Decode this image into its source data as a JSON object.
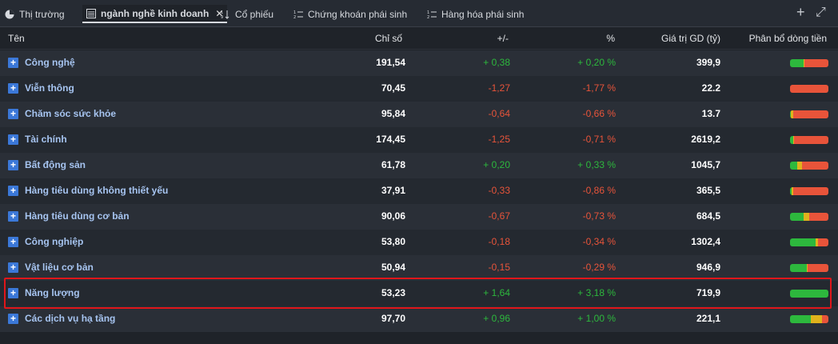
{
  "tabs": [
    {
      "label": "Thị trường",
      "icon": "pie-chart-icon",
      "active": false
    },
    {
      "label": "ngành nghề kinh doanh",
      "icon": "list-icon",
      "active": true
    },
    {
      "label": "Cổ phiếu",
      "icon": "sort-icon",
      "active": false
    },
    {
      "label": "Chứng khoán phái sinh",
      "icon": "sort-list-icon",
      "active": false
    },
    {
      "label": "Hàng hóa phái sinh",
      "icon": "sort-list-icon",
      "active": false
    }
  ],
  "toolbar": {
    "add_label": "+",
    "expand_label": "⤢"
  },
  "columns": {
    "name": "Tên",
    "index": "Chỉ số",
    "change": "+/-",
    "percent": "%",
    "value": "Giá trị GD (tỷ)",
    "flow": "Phân bổ dòng tiền"
  },
  "colors": {
    "up": "#2db83d",
    "down": "#e8543a",
    "flat": "#e0b21c",
    "highlight": "#e0161a"
  },
  "rows": [
    {
      "name": "Công nghệ",
      "index": "191,54",
      "change": "+ 0,38",
      "percent": "+ 0,20 %",
      "value": "399,9",
      "trend": "up",
      "flow": {
        "up": 0.35,
        "flat": 0.02,
        "down": 0.63
      }
    },
    {
      "name": "Viễn thông",
      "index": "70,45",
      "change": "-1,27",
      "percent": "-1,77 %",
      "value": "22.2",
      "trend": "down",
      "flow": {
        "up": 0.0,
        "flat": 0.0,
        "down": 1.0
      }
    },
    {
      "name": "Chăm sóc sức khỏe",
      "index": "95,84",
      "change": "-0,64",
      "percent": "-0,66 %",
      "value": "13.7",
      "trend": "down",
      "flow": {
        "up": 0.02,
        "flat": 0.06,
        "down": 0.92
      }
    },
    {
      "name": "Tài chính",
      "index": "174,45",
      "change": "-1,25",
      "percent": "-0,71 %",
      "value": "2619,2",
      "trend": "down",
      "flow": {
        "up": 0.09,
        "flat": 0.02,
        "down": 0.89
      }
    },
    {
      "name": "Bất động sản",
      "index": "61,78",
      "change": "+ 0,20",
      "percent": "+ 0,33 %",
      "value": "1045,7",
      "trend": "up",
      "flow": {
        "up": 0.19,
        "flat": 0.12,
        "down": 0.69
      }
    },
    {
      "name": "Hàng tiêu dùng không thiết yếu",
      "index": "37,91",
      "change": "-0,33",
      "percent": "-0,86 %",
      "value": "365,5",
      "trend": "down",
      "flow": {
        "up": 0.04,
        "flat": 0.04,
        "down": 0.92
      }
    },
    {
      "name": "Hàng tiêu dùng cơ bản",
      "index": "90,06",
      "change": "-0,67",
      "percent": "-0,73 %",
      "value": "684,5",
      "trend": "down",
      "flow": {
        "up": 0.35,
        "flat": 0.15,
        "down": 0.5
      }
    },
    {
      "name": "Công nghiệp",
      "index": "53,80",
      "change": "-0,18",
      "percent": "-0,34 %",
      "value": "1302,4",
      "trend": "down",
      "flow": {
        "up": 0.66,
        "flat": 0.06,
        "down": 0.28
      }
    },
    {
      "name": "Vật liệu cơ bản",
      "index": "50,94",
      "change": "-0,15",
      "percent": "-0,29 %",
      "value": "946,9",
      "trend": "down",
      "flow": {
        "up": 0.44,
        "flat": 0.02,
        "down": 0.54
      }
    },
    {
      "name": "Năng lượng",
      "index": "53,23",
      "change": "+ 1,64",
      "percent": "+ 3,18 %",
      "value": "719,9",
      "trend": "up",
      "flow": {
        "up": 1.0,
        "flat": 0.0,
        "down": 0.0
      }
    },
    {
      "name": "Các dịch vụ hạ tầng",
      "index": "97,70",
      "change": "+ 0,96",
      "percent": "+ 1,00 %",
      "value": "221,1",
      "trend": "up",
      "flow": {
        "up": 0.55,
        "flat": 0.29,
        "down": 0.16
      }
    }
  ]
}
